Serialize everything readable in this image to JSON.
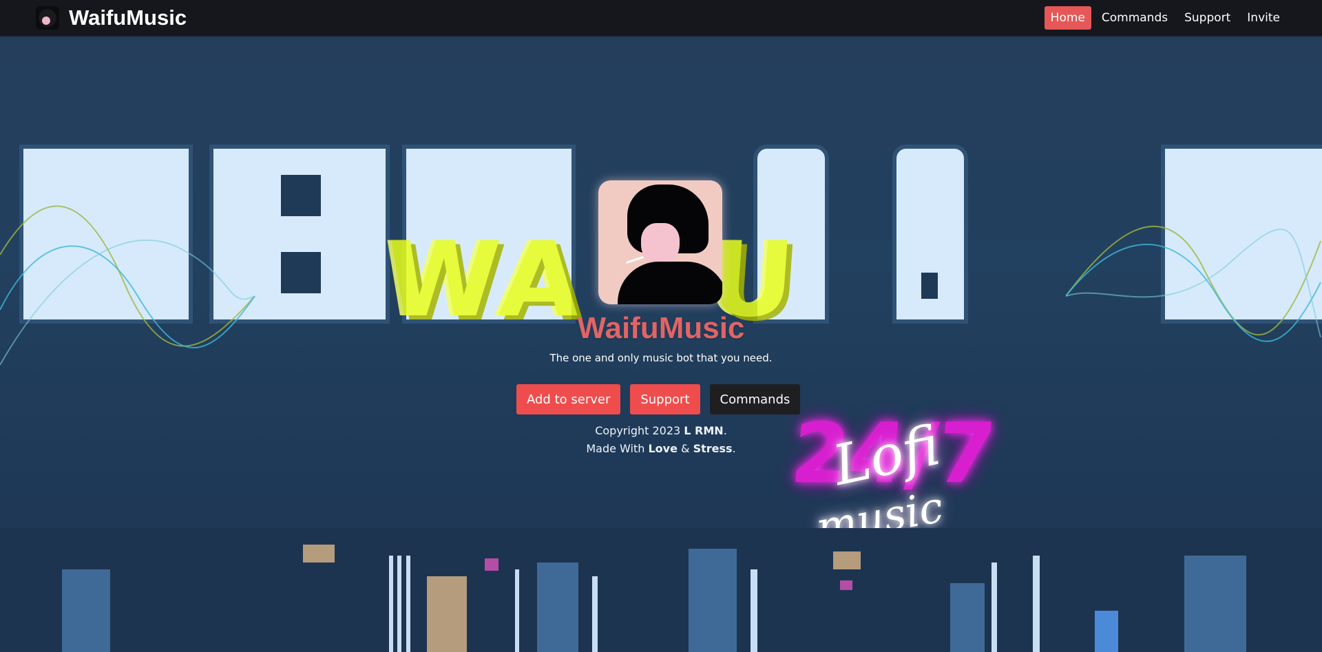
{
  "navbar": {
    "brand_name": "WaifuMusic",
    "links": [
      {
        "label": "Home",
        "active": true
      },
      {
        "label": "Commands",
        "active": false
      },
      {
        "label": "Support",
        "active": false
      },
      {
        "label": "Invite",
        "active": false
      }
    ]
  },
  "hero": {
    "title": "WaifuMusic",
    "tagline": "The one and only music bot that you need.",
    "buttons": {
      "add_to_server": "Add to server",
      "support": "Support",
      "commands": "Commands"
    },
    "copyright_prefix": "Copyright 2023",
    "copyright_owner": "L RMN",
    "copyright_suffix": ".",
    "made_with_prefix": "Made With",
    "made_with_love": "Love",
    "made_with_amp": "&",
    "made_with_stress": "Stress",
    "made_with_suffix": "."
  },
  "background": {
    "neon_sign_247": "24/7",
    "neon_sign_lofi": "Lofi",
    "neon_sign_music": "music"
  },
  "colors": {
    "accent_red": "#ef4d4d",
    "active_nav": "#e65757",
    "title_color": "#e06565",
    "navbar_bg": "#15171d",
    "page_bg": "#24415f"
  }
}
